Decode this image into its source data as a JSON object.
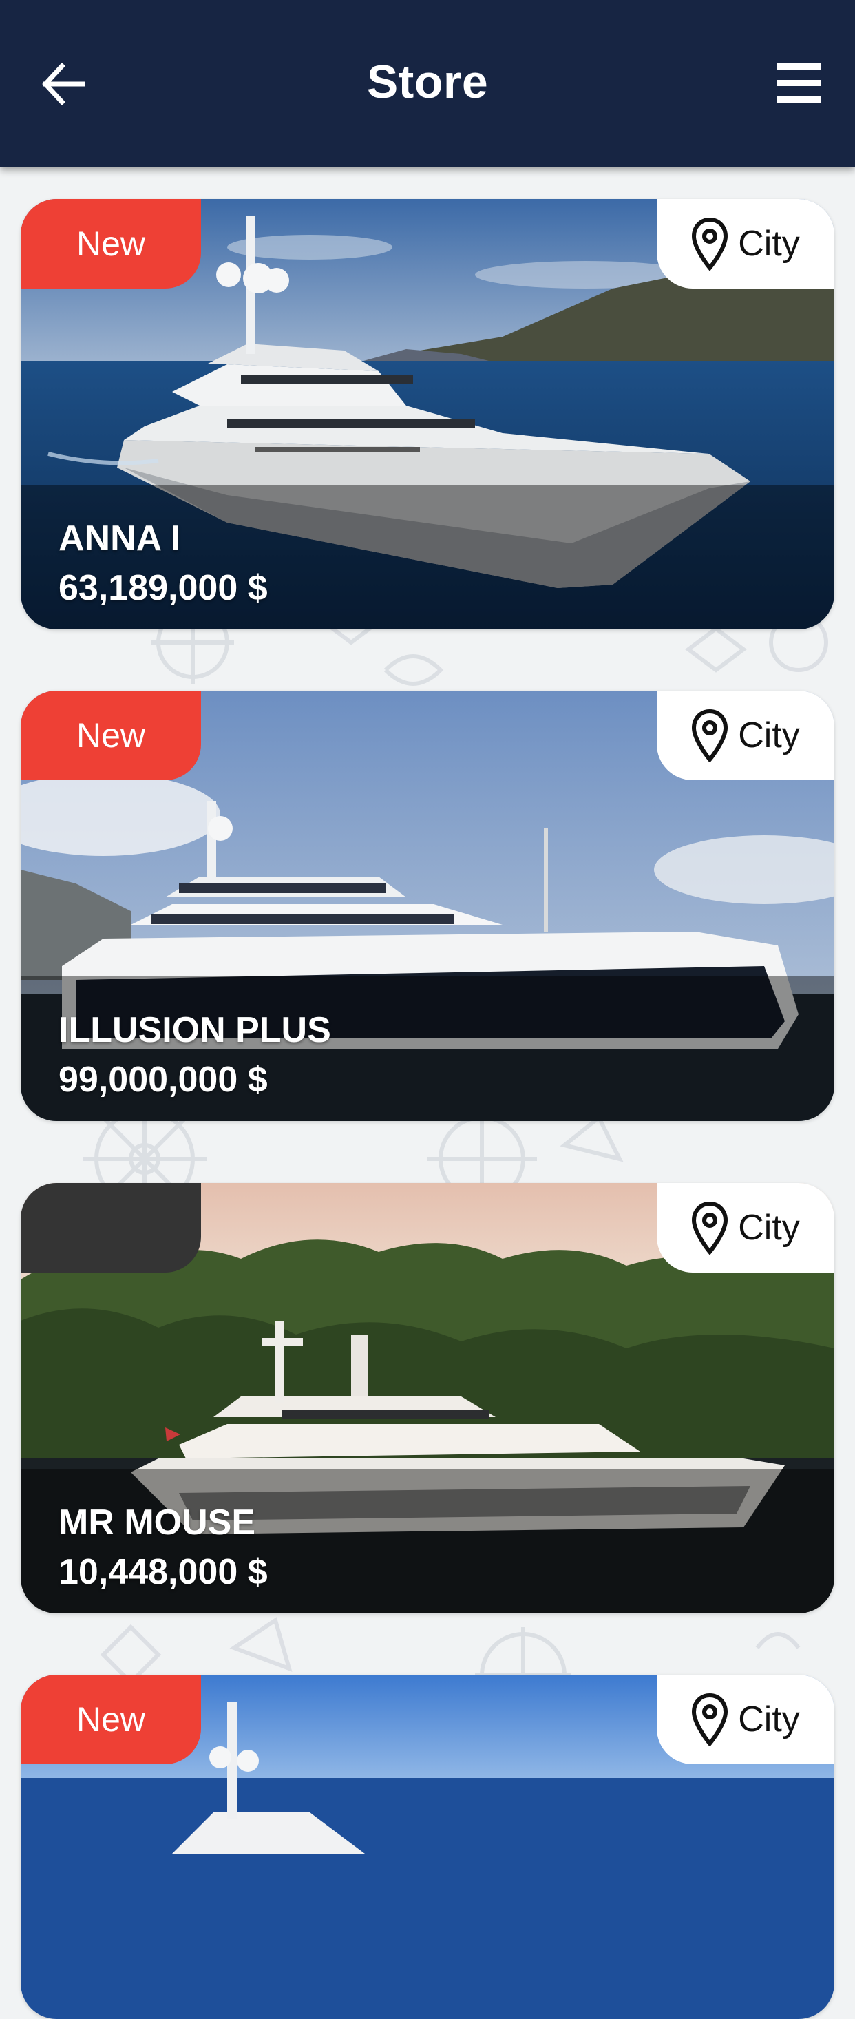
{
  "header": {
    "title": "Store",
    "back_icon": "arrow-left-icon",
    "menu_icon": "hamburger-menu-icon"
  },
  "colors": {
    "header_bg": "#172543",
    "badge_new": "#ee4035",
    "badge_empty": "#343434"
  },
  "listings": [
    {
      "badge": "New",
      "location": "City",
      "name": "ANNA I",
      "price": "63,189,000 $"
    },
    {
      "badge": "New",
      "location": "City",
      "name": "ILLUSION PLUS",
      "price": "99,000,000 $"
    },
    {
      "badge": "",
      "location": "City",
      "name": "MR MOUSE",
      "price": "10,448,000 $"
    },
    {
      "badge": "New",
      "location": "City",
      "name": "",
      "price": ""
    }
  ]
}
